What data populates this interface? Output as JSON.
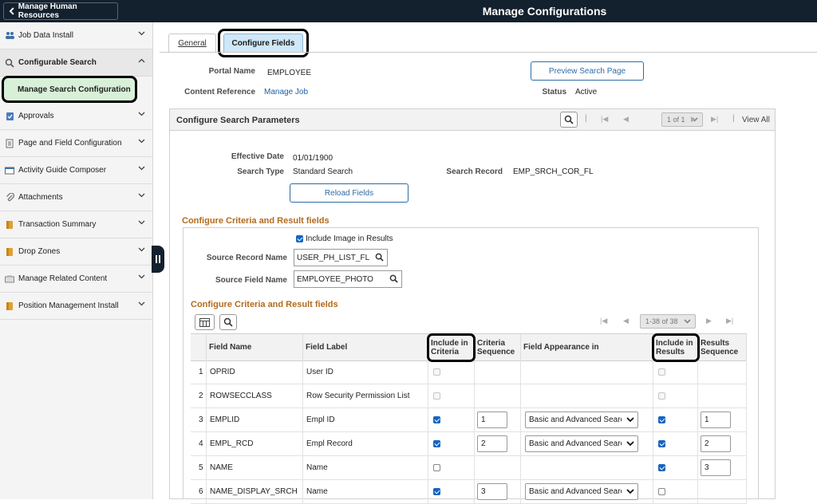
{
  "header": {
    "back_label": "Manage Human Resources",
    "page_title": "Manage Configurations",
    "bg_color": "#13202d"
  },
  "sidebar": {
    "items": [
      {
        "label": "Job Data Install",
        "icon": "people-icon"
      },
      {
        "label": "Configurable Search",
        "icon": "search-icon",
        "expanded": true
      },
      {
        "label": "Manage Search Configuration",
        "active": true
      },
      {
        "label": "Approvals",
        "icon": "approvals-icon"
      },
      {
        "label": "Page and Field Configuration",
        "icon": "page-icon"
      },
      {
        "label": "Activity Guide Composer",
        "icon": "guide-icon"
      },
      {
        "label": "Attachments",
        "icon": "paperclip-icon"
      },
      {
        "label": "Transaction Summary",
        "icon": "folder-icon"
      },
      {
        "label": "Drop Zones",
        "icon": "folder-icon"
      },
      {
        "label": "Manage Related Content",
        "icon": "related-content-icon"
      },
      {
        "label": "Position Management Install",
        "icon": "folder-icon"
      }
    ]
  },
  "tabs": [
    {
      "label": "General",
      "selected": false
    },
    {
      "label": "Configure Fields",
      "selected": true
    }
  ],
  "info": {
    "portal_name_label": "Portal Name",
    "portal_name_value": "EMPLOYEE",
    "content_ref_label": "Content Reference",
    "content_ref_value": "Manage Job",
    "preview_button": "Preview Search Page",
    "status_label": "Status",
    "status_value": "Active"
  },
  "params_panel": {
    "title": "Configure Search Parameters",
    "pager_text": "1 of 1",
    "view_all": "View All",
    "effective_date_label": "Effective Date",
    "effective_date_value": "01/01/1900",
    "search_type_label": "Search Type",
    "search_type_value": "Standard Search",
    "search_record_label": "Search Record",
    "search_record_value": "EMP_SRCH_COR_FL",
    "reload_button": "Reload Fields"
  },
  "criteria_section": {
    "title": "Configure Criteria and Result fields",
    "include_image_label": "Include Image in Results",
    "include_image_checked": true,
    "source_record_label": "Source Record Name",
    "source_record_value": "USER_PH_LIST_FL",
    "source_field_label": "Source Field Name",
    "source_field_value": "EMPLOYEE_PHOTO",
    "grid_title": "Configure Criteria and Result fields",
    "grid_pager": "1-38 of 38"
  },
  "grid": {
    "columns": [
      "Field Name",
      "Field Label",
      "Include in Criteria",
      "Criteria Sequence",
      "Field Appearance in",
      "Include in Results",
      "Results Sequence"
    ],
    "rows": [
      {
        "num": "1",
        "field_name": "OPRID",
        "field_label": "User ID",
        "include_criteria": "disabled",
        "criteria_seq": null,
        "appearance": null,
        "include_results": "disabled",
        "results_seq": null
      },
      {
        "num": "2",
        "field_name": "ROWSECCLASS",
        "field_label": "Row Security Permission List",
        "include_criteria": "disabled",
        "criteria_seq": null,
        "appearance": null,
        "include_results": "disabled",
        "results_seq": null
      },
      {
        "num": "3",
        "field_name": "EMPLID",
        "field_label": "Empl ID",
        "include_criteria": "checked",
        "criteria_seq": "1",
        "appearance": "Basic and Advanced Search",
        "include_results": "checked",
        "results_seq": "1"
      },
      {
        "num": "4",
        "field_name": "EMPL_RCD",
        "field_label": "Empl Record",
        "include_criteria": "checked",
        "criteria_seq": "2",
        "appearance": "Basic and Advanced Search",
        "include_results": "checked",
        "results_seq": "2"
      },
      {
        "num": "5",
        "field_name": "NAME",
        "field_label": "Name",
        "include_criteria": "unchecked",
        "criteria_seq": null,
        "appearance": null,
        "include_results": "checked",
        "results_seq": "3"
      },
      {
        "num": "6",
        "field_name": "NAME_DISPLAY_SRCH",
        "field_label": "Name",
        "include_criteria": "checked",
        "criteria_seq": "3",
        "appearance": "Basic and Advanced Search",
        "include_results": "unchecked",
        "results_seq": null
      }
    ]
  },
  "colors": {
    "accent_blue": "#1565c0",
    "link_blue": "#1f5fa8",
    "section_orange": "#b36b1c",
    "active_green": "#d8f0d8"
  }
}
